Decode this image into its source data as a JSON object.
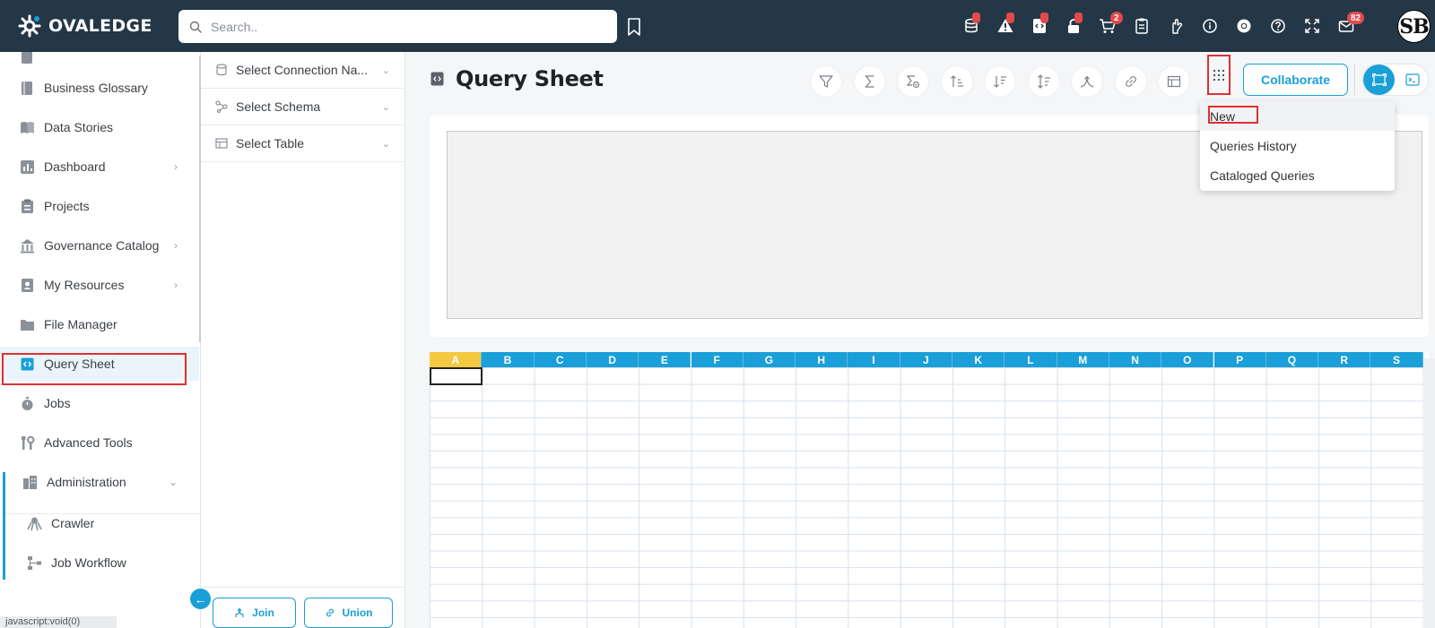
{
  "app": {
    "logo_text": "OVALEDGE"
  },
  "search": {
    "placeholder": "Search.."
  },
  "topbar": {
    "icons": [
      {
        "name": "database-icon",
        "dot": true
      },
      {
        "name": "alert-triangle-icon",
        "dot": true
      },
      {
        "name": "code-file-icon",
        "dot": true
      },
      {
        "name": "lock-icon",
        "dot": true
      },
      {
        "name": "cart-icon",
        "badge": "2"
      },
      {
        "name": "clipboard-icon"
      },
      {
        "name": "hand-icon"
      },
      {
        "name": "info-icon"
      },
      {
        "name": "chrome-icon"
      },
      {
        "name": "help-icon"
      },
      {
        "name": "expand-icon"
      },
      {
        "name": "mail-icon",
        "badge": "82"
      }
    ],
    "avatar_initials": "SB"
  },
  "sidebar": {
    "items": [
      {
        "label": "Business Glossary",
        "icon": "glossary-icon",
        "chevron": false
      },
      {
        "label": "Data Stories",
        "icon": "book-icon",
        "chevron": false
      },
      {
        "label": "Dashboard",
        "icon": "dashboard-icon",
        "chevron": true
      },
      {
        "label": "Projects",
        "icon": "clipboard-list-icon",
        "chevron": false
      },
      {
        "label": "Governance Catalog",
        "icon": "bank-icon",
        "chevron": true
      },
      {
        "label": "My Resources",
        "icon": "contact-icon",
        "chevron": true
      },
      {
        "label": "File Manager",
        "icon": "folder-icon",
        "chevron": false
      },
      {
        "label": "Query Sheet",
        "icon": "code-file-icon",
        "chevron": false,
        "active": true
      },
      {
        "label": "Jobs",
        "icon": "stopwatch-icon",
        "chevron": false
      },
      {
        "label": "Advanced Tools",
        "icon": "tools-icon",
        "chevron": false
      },
      {
        "label": "Administration",
        "icon": "building-icon",
        "chevron": true,
        "expanded": true
      },
      {
        "label": "Crawler",
        "icon": "crawler-icon",
        "chevron": false,
        "sub": true
      },
      {
        "label": "Job Workflow",
        "icon": "workflow-icon",
        "chevron": false,
        "sub": true
      }
    ],
    "status_text": "javascript:void(0)",
    "collapse_glyph": "←"
  },
  "panel": {
    "selects": [
      {
        "label": "Select Connection Na...",
        "icon": "database-icon"
      },
      {
        "label": "Select Schema",
        "icon": "schema-icon"
      },
      {
        "label": "Select Table",
        "icon": "table-icon"
      }
    ],
    "join_label": "Join",
    "union_label": "Union"
  },
  "main": {
    "title": "Query Sheet",
    "toolbar": [
      "filter-icon",
      "sigma-icon",
      "formula-icon",
      "sort-asc-icon",
      "sort-desc-icon",
      "sort-icon",
      "join-icon",
      "link-icon",
      "table-icon"
    ],
    "collaborate_label": "Collaborate",
    "menu": [
      "New",
      "Queries History",
      "Cataloged Queries"
    ],
    "columns": [
      "A",
      "B",
      "C",
      "D",
      "E",
      "F",
      "G",
      "H",
      "I",
      "J",
      "K",
      "L",
      "M",
      "N",
      "O",
      "P",
      "Q",
      "R",
      "S"
    ]
  },
  "colors": {
    "topbar": "#243746",
    "accent": "#1a9fd8",
    "highlight": "#e03030",
    "selected_column": "#f5c842",
    "badge": "#e24a4a"
  }
}
